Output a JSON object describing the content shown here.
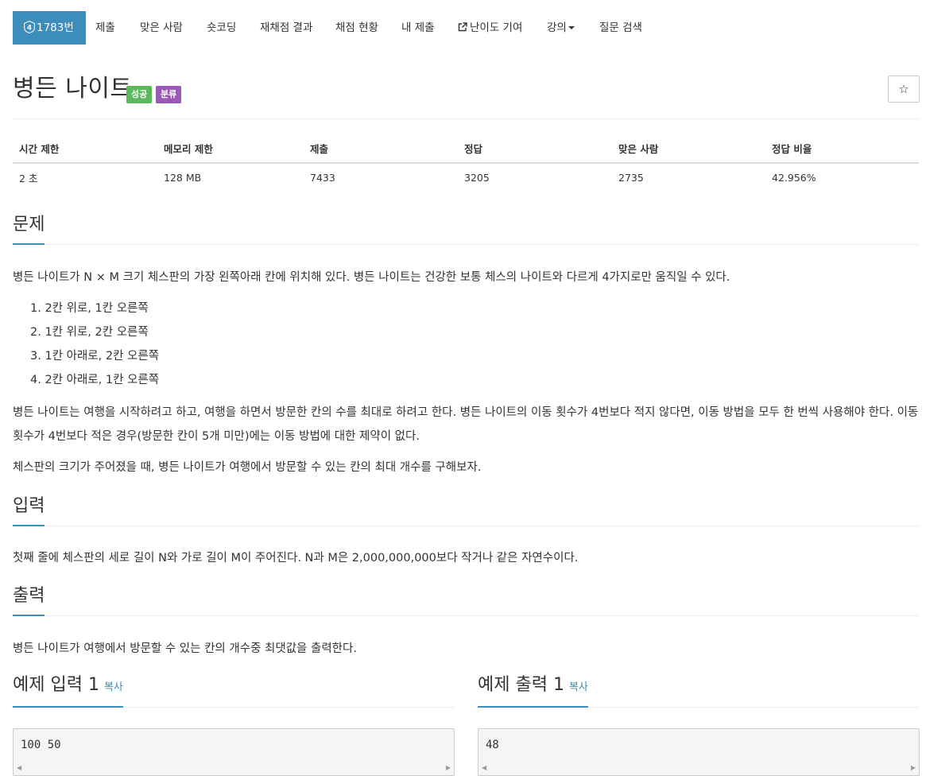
{
  "nav": {
    "problem_number": "1783번",
    "tier_number": "4",
    "tabs": [
      "제출",
      "맞은 사람",
      "숏코딩",
      "재채점 결과",
      "채점 현황",
      "내 제출",
      "난이도 기여",
      "강의",
      "질문 검색"
    ]
  },
  "title": "병든 나이트",
  "labels": {
    "success": "성공",
    "category": "분류"
  },
  "star": "☆",
  "info": {
    "headers": [
      "시간 제한",
      "메모리 제한",
      "제출",
      "정답",
      "맞은 사람",
      "정답 비율"
    ],
    "values": [
      "2 초",
      "128 MB",
      "7433",
      "3205",
      "2735",
      "42.956%"
    ]
  },
  "problem": {
    "heading": "문제",
    "intro": "병든 나이트가 N × M 크기 체스판의 가장 왼쪽아래 칸에 위치해 있다. 병든 나이트는 건강한 보통 체스의 나이트와 다르게 4가지로만 움직일 수 있다.",
    "moves": [
      "1. 2칸 위로, 1칸 오른쪽",
      "2. 1칸 위로, 2칸 오른쪽",
      "3. 1칸 아래로, 2칸 오른쪽",
      "4. 2칸 아래로, 1칸 오른쪽"
    ],
    "para2": "병든 나이트는 여행을 시작하려고 하고, 여행을 하면서 방문한 칸의 수를 최대로 하려고 한다. 병든 나이트의 이동 횟수가 4번보다 적지 않다면, 이동 방법을 모두 한 번씩 사용해야 한다. 이동 횟수가 4번보다 적은 경우(방문한 칸이 5개 미만)에는 이동 방법에 대한 제약이 없다.",
    "para3": "체스판의 크기가 주어졌을 때, 병든 나이트가 여행에서 방문할 수 있는 칸의 최대 개수를 구해보자."
  },
  "input": {
    "heading": "입력",
    "text": "첫째 줄에 체스판의 세로 길이 N와 가로 길이 M이 주어진다. N과 M은 2,000,000,000보다 작거나 같은 자연수이다."
  },
  "output": {
    "heading": "출력",
    "text": "병든 나이트가 여행에서 방문할 수 있는 칸의 개수중 최댓값을 출력한다."
  },
  "samples": {
    "input_heading": "예제 입력 1",
    "output_heading": "예제 출력 1",
    "copy_label": "복사",
    "input_value": "100 50",
    "output_value": "48"
  },
  "colors": {
    "accent": "#3c8dbc",
    "success": "#5cb85c",
    "purple": "#9b59b6"
  }
}
